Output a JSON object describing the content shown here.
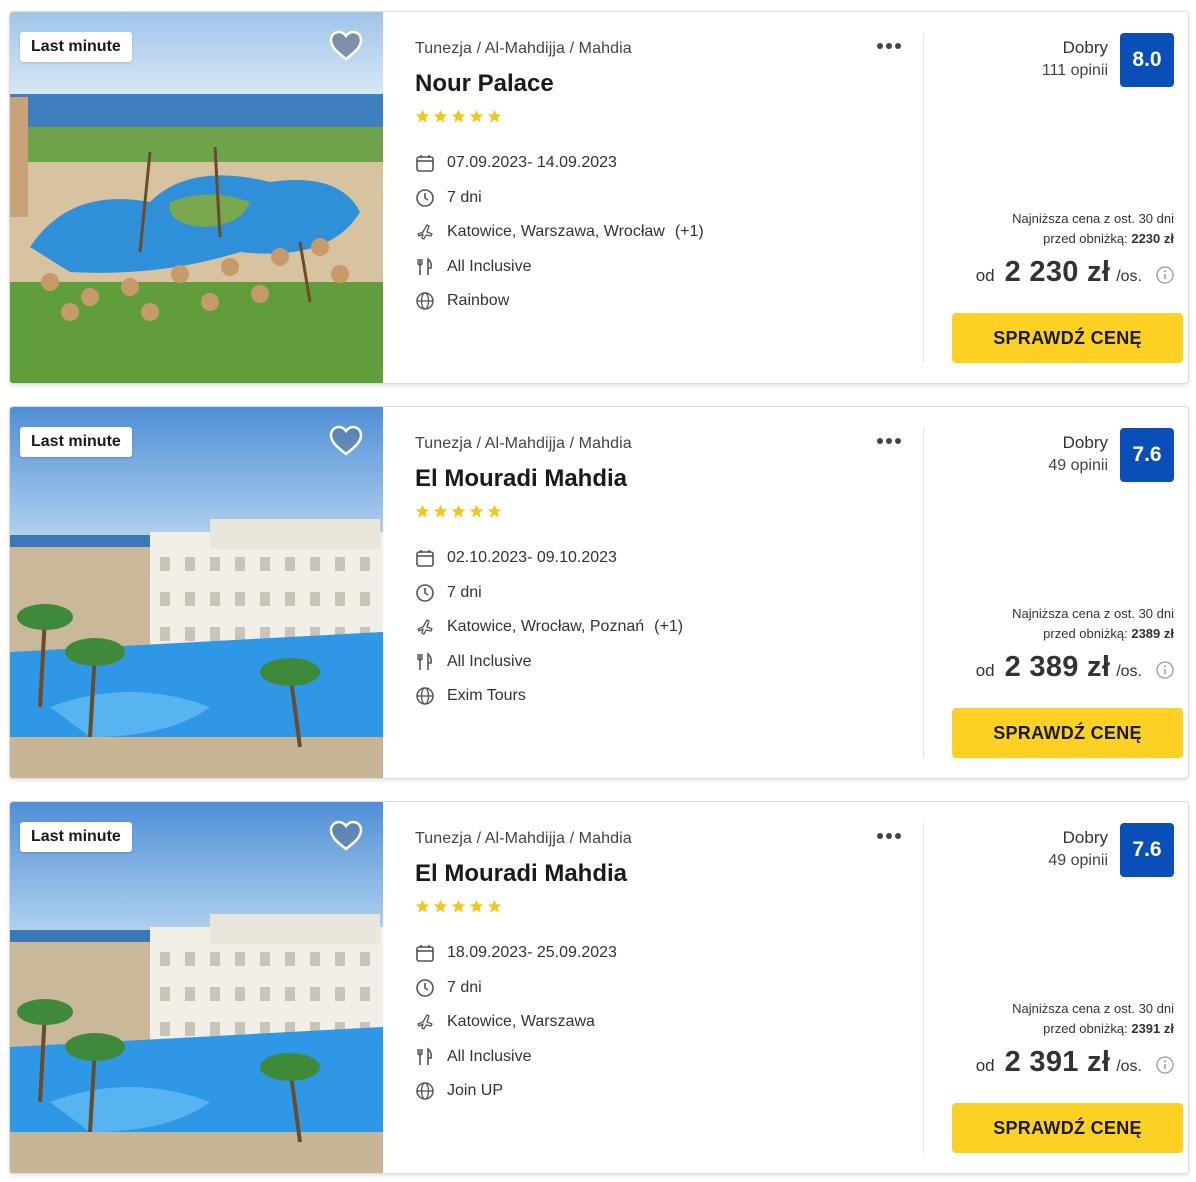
{
  "colors": {
    "accent_yellow": "#fdd123",
    "score_blue": "#0a4fb8",
    "star_yellow": "#f5c518"
  },
  "offers": [
    {
      "badge": "Last minute",
      "location": "Tunezja / Al-Mahdijja / Mahdia",
      "name": "Nour Palace",
      "stars": 5,
      "dates": "07.09.2023- 14.09.2023",
      "duration": "7 dni",
      "departures": "Katowice, Warszawa, Wrocław",
      "departures_extra": "(+1)",
      "board": "All Inclusive",
      "operator": "Rainbow",
      "rating_word": "Dobry",
      "rating_count": "111 opinii",
      "score": "8.0",
      "lowest_line1": "Najniższa cena z ost. 30 dni",
      "lowest_line2_prefix": "przed obniżką:",
      "lowest_value": "2230 zł",
      "price_prefix": "od",
      "price": "2 230 zł",
      "price_unit": "/os.",
      "cta": "SPRAWDŹ CENĘ",
      "favorite_icon": "heart-icon",
      "image": "pool-resort"
    },
    {
      "badge": "Last minute",
      "location": "Tunezja / Al-Mahdijja / Mahdia",
      "name": "El Mouradi Mahdia",
      "stars": 5,
      "dates": "02.10.2023- 09.10.2023",
      "duration": "7 dni",
      "departures": "Katowice, Wrocław, Poznań",
      "departures_extra": "(+1)",
      "board": "All Inclusive",
      "operator": "Exim Tours",
      "rating_word": "Dobry",
      "rating_count": "49 opinii",
      "score": "7.6",
      "lowest_line1": "Najniższa cena z ost. 30 dni",
      "lowest_line2_prefix": "przed obniżką:",
      "lowest_value": "2389 zł",
      "price_prefix": "od",
      "price": "2 389 zł",
      "price_unit": "/os.",
      "cta": "SPRAWDŹ CENĘ",
      "favorite_icon": "heart-icon",
      "image": "hotel-seaside"
    },
    {
      "badge": "Last minute",
      "location": "Tunezja / Al-Mahdijja / Mahdia",
      "name": "El Mouradi Mahdia",
      "stars": 5,
      "dates": "18.09.2023- 25.09.2023",
      "duration": "7 dni",
      "departures": "Katowice, Warszawa",
      "departures_extra": "",
      "board": "All Inclusive",
      "operator": "Join UP",
      "rating_word": "Dobry",
      "rating_count": "49 opinii",
      "score": "7.6",
      "lowest_line1": "Najniższa cena z ost. 30 dni",
      "lowest_line2_prefix": "przed obniżką:",
      "lowest_value": "2391 zł",
      "price_prefix": "od",
      "price": "2 391 zł",
      "price_unit": "/os.",
      "cta": "SPRAWDŹ CENĘ",
      "favorite_icon": "heart-icon",
      "image": "hotel-seaside"
    }
  ]
}
